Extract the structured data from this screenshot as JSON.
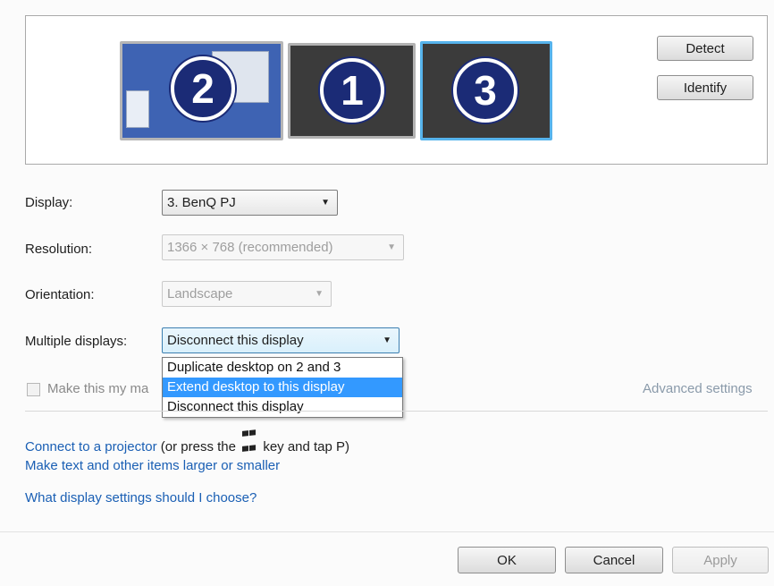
{
  "buttons": {
    "detect": "Detect",
    "identify": "Identify",
    "ok": "OK",
    "cancel": "Cancel",
    "apply": "Apply"
  },
  "monitors": [
    {
      "number": "2",
      "state": "selected-background"
    },
    {
      "number": "1",
      "state": "normal"
    },
    {
      "number": "3",
      "state": "selected"
    }
  ],
  "form": {
    "display": {
      "label": "Display:",
      "value": "3. BenQ PJ"
    },
    "resolution": {
      "label": "Resolution:",
      "value": "1366 × 768 (recommended)"
    },
    "orientation": {
      "label": "Orientation:",
      "value": "Landscape"
    },
    "multiple_displays": {
      "label": "Multiple displays:",
      "value": "Disconnect this display",
      "options": [
        "Duplicate desktop on 2 and 3",
        "Extend desktop to this display",
        "Disconnect this display"
      ],
      "highlighted_index": 1
    }
  },
  "checkbox": {
    "label": "Make this my ma",
    "checked": false
  },
  "advanced_settings": "Advanced settings",
  "links": {
    "projector": "Connect to a projector",
    "projector_tail_1": "(or press the",
    "projector_tail_2": "key and tap P)",
    "text_size": "Make text and other items larger or smaller",
    "help": "What display settings should I choose?"
  },
  "icons": {
    "windows_key": "windows-logo-icon",
    "dropdown_arrow": "chevron-down-icon"
  },
  "colors": {
    "link": "#1a5fb4",
    "highlight": "#3399ff",
    "monitor_selected_border": "#56b3ec",
    "number_circle": "#1b2b76"
  }
}
